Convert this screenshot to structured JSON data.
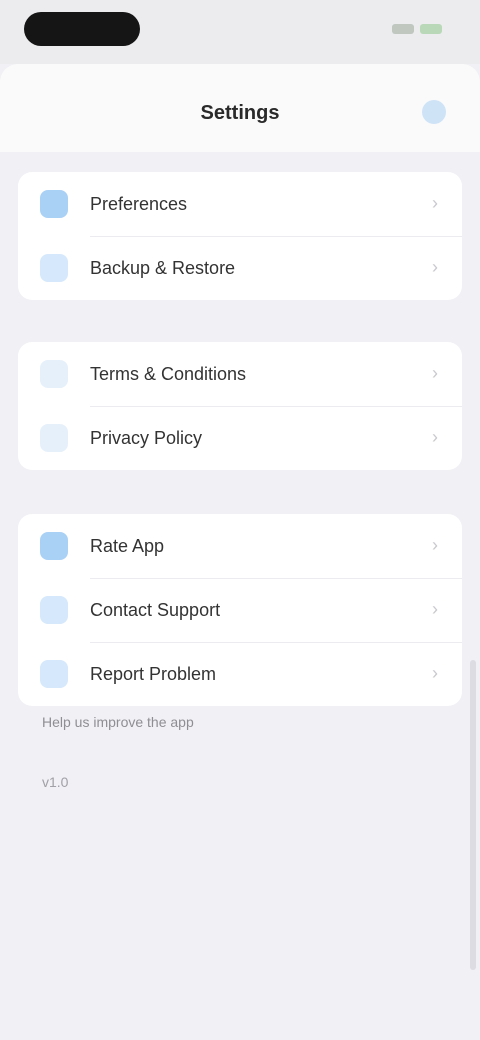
{
  "nav": {
    "title": "Settings"
  },
  "groups": [
    {
      "items": [
        {
          "label": "Preferences",
          "icon": "gear-icon",
          "icon_color": "#a9d0f5"
        },
        {
          "label": "Backup & Restore",
          "icon": "backup-icon",
          "icon_color": "#d6e8fb"
        }
      ]
    },
    {
      "items": [
        {
          "label": "Terms & Conditions",
          "icon": "document-icon",
          "icon_color": "#e6f0fb"
        },
        {
          "label": "Privacy Policy",
          "icon": "lock-icon",
          "icon_color": "#e6f0fb"
        }
      ]
    },
    {
      "items": [
        {
          "label": "Rate App",
          "icon": "star-icon",
          "icon_color": "#a9d0f5"
        },
        {
          "label": "Contact Support",
          "icon": "support-icon",
          "icon_color": "#d6e8fb"
        },
        {
          "label": "Report Problem",
          "icon": "report-icon",
          "icon_color": "#d6e8fb"
        }
      ]
    }
  ],
  "footnote": "Help us improve the app",
  "version": "v1.0"
}
